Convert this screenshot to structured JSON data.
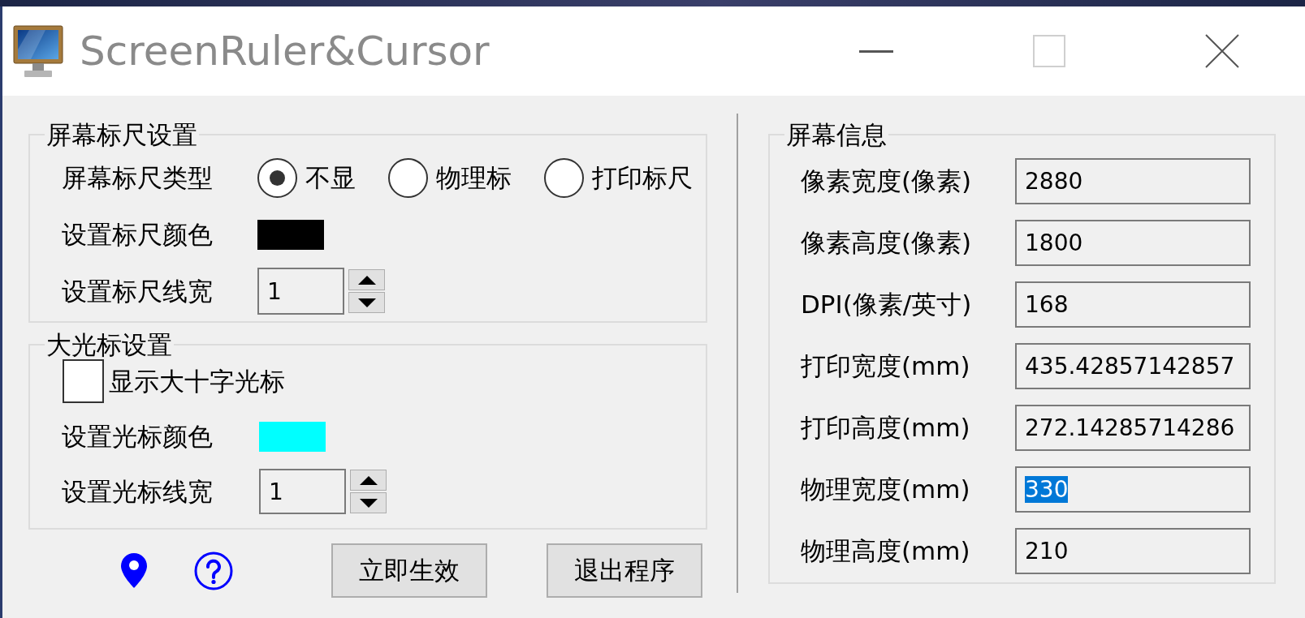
{
  "window": {
    "title": "ScreenRuler&Cursor",
    "controls": [
      {
        "kind": "minimize",
        "disabled": false
      },
      {
        "kind": "maximize",
        "disabled": true
      },
      {
        "kind": "close",
        "disabled": false
      }
    ]
  },
  "ruler_settings": {
    "legend": "屏幕标尺设置",
    "type_label": "屏幕标尺类型",
    "ruler_types": [
      {
        "label": "不显",
        "selected": true
      },
      {
        "label": "物理标",
        "selected": false
      },
      {
        "label": "打印标尺",
        "selected": false
      }
    ],
    "color_label": "设置标尺颜色",
    "color": "#000000",
    "width_label": "设置标尺线宽",
    "width_value": "1"
  },
  "cursor_settings": {
    "legend": "大光标设置",
    "show_crosshair": {
      "label": "显示大十字光标",
      "checked": false
    },
    "color_label": "设置光标颜色",
    "color": "#00ffff",
    "width_label": "设置光标线宽",
    "width_value": "1"
  },
  "footer": {
    "buttons": [
      "立即生效",
      "退出程序"
    ]
  },
  "screen_info": {
    "legend": "屏幕信息",
    "rows": [
      {
        "label": "像素宽度(像素)",
        "value": "2880",
        "selected": false
      },
      {
        "label": "像素高度(像素)",
        "value": "1800",
        "selected": false
      },
      {
        "label": "DPI(像素/英寸)",
        "value": "168",
        "selected": false
      },
      {
        "label": "打印宽度(mm)",
        "value": "435.42857142857",
        "selected": false
      },
      {
        "label": "打印高度(mm)",
        "value": "272.14285714286",
        "selected": false
      },
      {
        "label": "物理宽度(mm)",
        "value": "330",
        "selected": true
      },
      {
        "label": "物理高度(mm)",
        "value": "210",
        "selected": false
      }
    ]
  }
}
